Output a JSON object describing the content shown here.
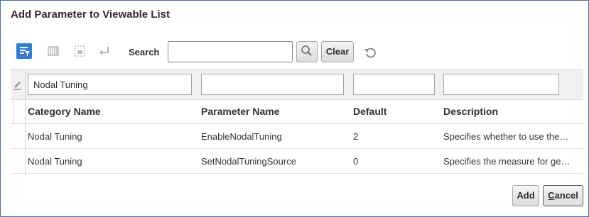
{
  "dialog": {
    "title": "Add Parameter to Viewable List"
  },
  "toolbar": {
    "search_label": "Search",
    "search_value": "",
    "clear_label": "Clear",
    "icons": [
      "query-by-example-icon",
      "freeze-columns-icon",
      "detach-icon",
      "wrap-icon",
      "search-icon",
      "refresh-icon"
    ]
  },
  "grid": {
    "filters": [
      "Nodal Tuning",
      "",
      "",
      ""
    ],
    "columns": [
      "Category Name",
      "Parameter Name",
      "Default",
      "Description"
    ],
    "rows": [
      [
        "Nodal Tuning",
        "EnableNodalTuning",
        "2",
        "Specifies whether to use the…"
      ],
      [
        "Nodal Tuning",
        "SetNodalTuningSource",
        "0",
        "Specifies the measure for ge…"
      ]
    ]
  },
  "footer": {
    "add_label": "Add",
    "cancel_first": "C",
    "cancel_rest": "ancel"
  },
  "colors": {
    "accent": "#2f7fd6",
    "border": "#4a6fa8"
  }
}
